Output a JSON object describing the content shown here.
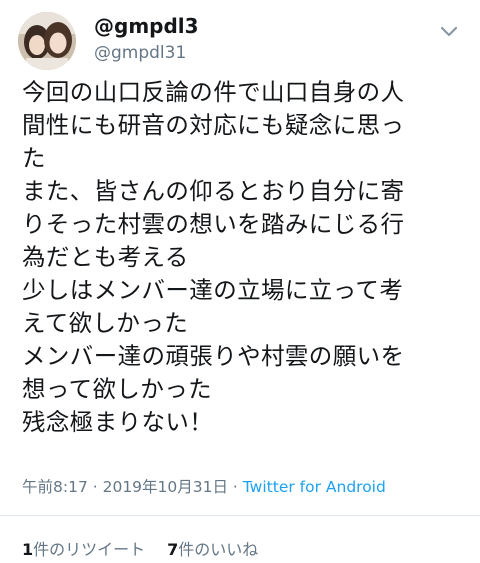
{
  "user": {
    "display_name": "@gmpdl3",
    "handle": "@gmpdl31",
    "avatar_icon": "user-photo-avatar"
  },
  "menu_icon": "chevron-down-icon",
  "tweet": {
    "lines": [
      "今回の山口反論の件で山口自身の人",
      "間性にも研音の対応にも疑念に思っ",
      "た",
      "また、皆さんの仰るとおり自分に寄",
      "りそった村雲の想いを踏みにじる行",
      "為だとも考える",
      "少しはメンバー達の立場に立って考",
      "えて欲しかった",
      "メンバー達の頑張りや村雲の願いを",
      "想って欲しかった",
      "残念極まりない！"
    ]
  },
  "meta": {
    "time": "午前8:17",
    "sep1": " · ",
    "date": "2019年10月31日",
    "sep2": " · ",
    "source": "Twitter for Android"
  },
  "stats": {
    "retweet_count": "1",
    "retweet_label": "件のリツイート",
    "like_count": "7",
    "like_label": "件のいいね"
  },
  "colors": {
    "accent": "#1da1f2",
    "secondary_text": "#657786",
    "divider": "#e1e8ed"
  }
}
